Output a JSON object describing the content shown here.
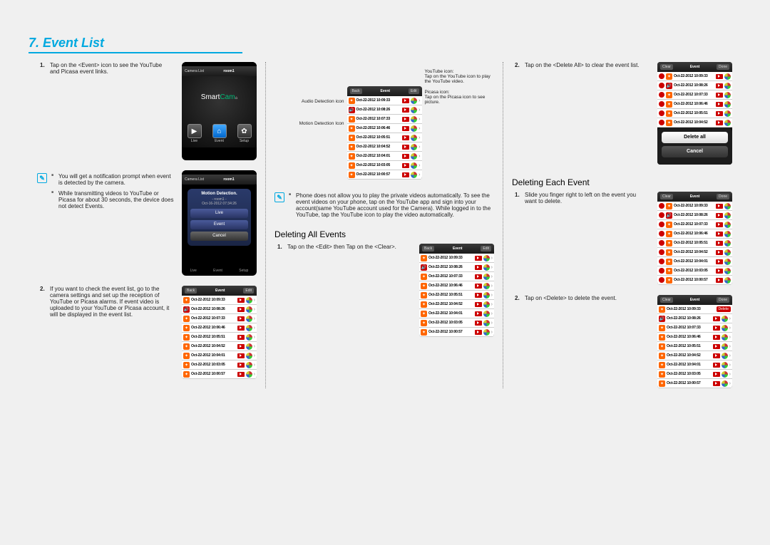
{
  "section": {
    "title": "7. Event List"
  },
  "col1": {
    "step1_num": "1.",
    "step1_txt": "Tap on the <Event> icon to see the YouTube and Picasa event links.",
    "note_items": [
      "You will get a notification prompt when event is detected by the camera.",
      "While transmitting videos to YouTube or Picasa for about 30 seconds, the device does not detect Events."
    ],
    "step2_num": "2.",
    "step2_txt": "If you want to check the event list, go to the camera settings and set up the reception of YouTube or Picasa alarms. If event video is uploaded to your YouTube or Picasa account, it will be displayed in the event list.",
    "phone_title_left": "Camera List",
    "phone_title_center": "room1",
    "phone_btn_live": "Live",
    "phone_btn_event": "Event",
    "phone_btn_setup": "Setup",
    "notif": {
      "title": "Motion Detection.",
      "sub1": "- room1 -",
      "sub2": "Oct-16-2012 07:34:26",
      "live": "Live",
      "event": "Event",
      "cancel": "Cancel"
    }
  },
  "col2": {
    "lbl_audio": "Audio Detection icon",
    "lbl_motion": "Motion Detection Icon",
    "lbl_yt": "YouTube icon:\nTap on the YouTube icon to play the YouTube video.",
    "lbl_pc": "Picasa icon:\nTap on the Picasa icon to see picture.",
    "note1": "Phone does not allow you to play the private videos automatically. To see the event videos on your phone, tap on the YouTube app and sign into your account(same YouTube account used for the Camera). While logged in to the YouTube, tap the YouTube icon to play the video automatically.",
    "h_del_all": "Deleting All Events",
    "step1_num": "1.",
    "step1_txt": "Tap on the <Edit> then Tap on the <Clear>.",
    "evt_hdr": {
      "left": "Back",
      "center": "Event",
      "right": "Edit"
    },
    "evt_rows": [
      {
        "t": "motion",
        "ts": "Oct-22-2012 10:09:33"
      },
      {
        "t": "audio",
        "ts": "Oct-22-2012 10:08:26"
      },
      {
        "t": "motion",
        "ts": "Oct-22-2012 10:07:33"
      },
      {
        "t": "motion",
        "ts": "Oct-22-2012 10:06:46"
      },
      {
        "t": "motion",
        "ts": "Oct-22-2012 10:05:51"
      },
      {
        "t": "motion",
        "ts": "Oct-22-2012 10:04:52"
      },
      {
        "t": "motion",
        "ts": "Oct-22-2012 10:04:01"
      },
      {
        "t": "motion",
        "ts": "Oct-22-2012 10:03:05"
      },
      {
        "t": "motion",
        "ts": "Oct-22-2012 10:00:57"
      }
    ]
  },
  "col3": {
    "step2_num": "2.",
    "step2_txt": "Tap on the <Delete All> to clear the event list.",
    "sheet_da": "Delete all",
    "sheet_cn": "Cancel",
    "h_del_each": "Deleting Each Event",
    "e_step1_num": "1.",
    "e_step1_txt": "Slide you finger right to left on the event you want to delete.",
    "e_step2_num": "2.",
    "e_step2_txt": "Tap on <Delete> to delete the event.",
    "hdr_clear": {
      "left": "Clear",
      "center": "Event",
      "right": "Done"
    },
    "del_btn": "Delete"
  },
  "evt_rows_std": [
    {
      "t": "motion",
      "ts": "Oct-22-2012 10:09:33"
    },
    {
      "t": "audio",
      "ts": "Oct-22-2012 10:08:26"
    },
    {
      "t": "motion",
      "ts": "Oct-22-2012 10:07:33"
    },
    {
      "t": "motion",
      "ts": "Oct-22-2012 10:06:46"
    },
    {
      "t": "motion",
      "ts": "Oct-22-2012 10:05:51"
    },
    {
      "t": "motion",
      "ts": "Oct-22-2012 10:04:52"
    },
    {
      "t": "motion",
      "ts": "Oct-22-2012 10:04:01"
    },
    {
      "t": "motion",
      "ts": "Oct-22-2012 10:03:05"
    },
    {
      "t": "motion",
      "ts": "Oct-22-2012 10:00:57"
    }
  ]
}
